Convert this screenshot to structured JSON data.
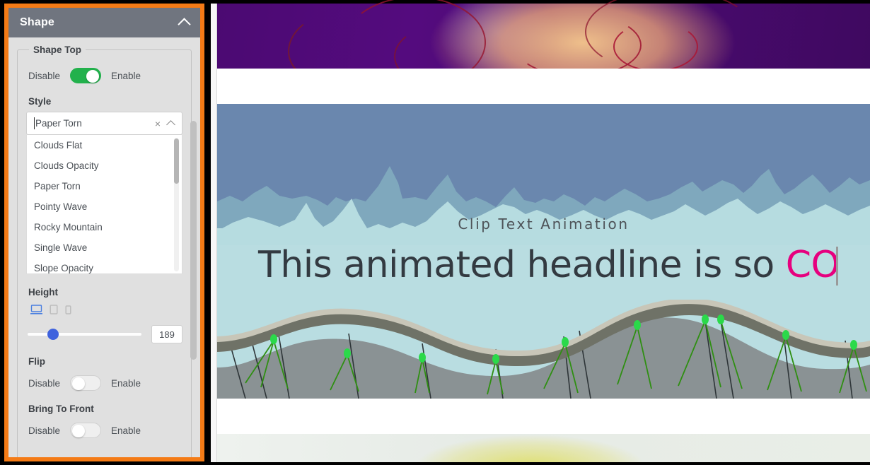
{
  "panel": {
    "header": {
      "title": "Shape",
      "collapse_icon": "chevron-up-icon"
    },
    "group": {
      "legend": "Shape Top"
    },
    "shape_top_toggle": {
      "off_label": "Disable",
      "on_label": "Enable",
      "state": "on"
    },
    "style": {
      "label": "Style",
      "value": "Paper Torn",
      "clear_icon": "close-icon",
      "chevron_icon": "chevron-up-icon",
      "options": [
        "Clouds Flat",
        "Clouds Opacity",
        "Paper Torn",
        "Pointy Wave",
        "Rocky Mountain",
        "Single Wave",
        "Slope Opacity"
      ]
    },
    "height": {
      "label": "Height",
      "devices": [
        {
          "name": "desktop-icon",
          "active": true
        },
        {
          "name": "tablet-icon",
          "active": false
        },
        {
          "name": "mobile-icon",
          "active": false
        }
      ],
      "value": "189"
    },
    "flip": {
      "label": "Flip",
      "off_label": "Disable",
      "on_label": "Enable",
      "state": "off"
    },
    "bring_to_front": {
      "label": "Bring To Front",
      "off_label": "Disable",
      "on_label": "Enable",
      "state": "off"
    },
    "colors": {
      "frame": "#f47b16",
      "header_bg": "#70757f",
      "toggle_on": "#22b14c",
      "slider_knob": "#3f62dd"
    }
  },
  "preview": {
    "hero": {
      "subtitle": "Clip Text Animation",
      "headline_plain": "This animated headline is so ",
      "headline_accent": "CO",
      "accent_color": "#e6007e"
    }
  }
}
